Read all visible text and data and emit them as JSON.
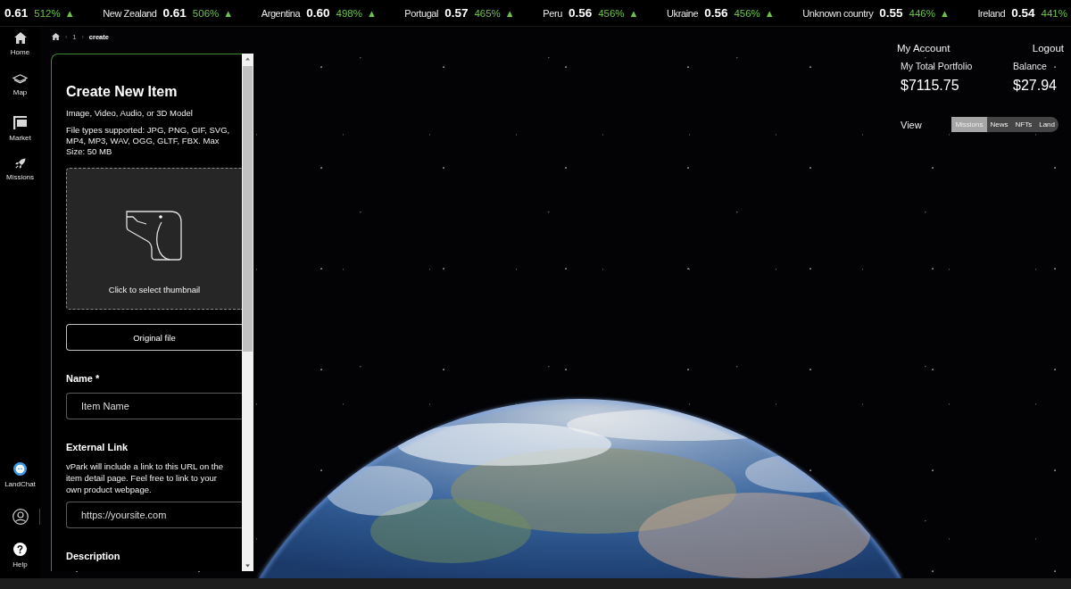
{
  "ticker": [
    {
      "value": "0.61",
      "change": "512%",
      "arrow": "▲"
    },
    {
      "name": "New Zealand",
      "value": "0.61",
      "change": "506%",
      "arrow": "▲"
    },
    {
      "name": "Argentina",
      "value": "0.60",
      "change": "498%",
      "arrow": "▲"
    },
    {
      "name": "Portugal",
      "value": "0.57",
      "change": "465%",
      "arrow": "▲"
    },
    {
      "name": "Peru",
      "value": "0.56",
      "change": "456%",
      "arrow": "▲"
    },
    {
      "name": "Ukraine",
      "value": "0.56",
      "change": "456%",
      "arrow": "▲"
    },
    {
      "name": "Unknown country",
      "value": "0.55",
      "change": "446%",
      "arrow": "▲"
    },
    {
      "name": "Ireland",
      "value": "0.54",
      "change": "441%"
    }
  ],
  "sidebar": {
    "items": [
      {
        "label": "Home"
      },
      {
        "label": "Map"
      },
      {
        "label": "Market"
      },
      {
        "label": "Missions"
      }
    ],
    "chat": {
      "label": "LandChat"
    },
    "help": {
      "label": "Help"
    }
  },
  "breadcrumb": [
    {
      "separator": "›",
      "label": "1"
    },
    {
      "separator": "›",
      "label": "create"
    }
  ],
  "form": {
    "title": "Create New Item",
    "subtitle": "Image, Video, Audio, or 3D Model",
    "file_types": "File types supported: JPG, PNG, GIF, SVG, MP4, MP3, WAV, OGG, GLTF, FBX. Max Size: 50 MB",
    "upload": {
      "label": "Click to select thumbnail"
    },
    "original_file_button": "Original file",
    "fields": [
      {
        "label": "Name *",
        "placeholder": "Item Name"
      },
      {
        "label": "External Link",
        "help": "vPark will include a link to this URL on the item detail page. Feel free to link to your own product webpage.",
        "placeholder": "https://yoursite.com"
      },
      {
        "label": "Description"
      }
    ]
  },
  "account": {
    "title": "My Account",
    "logout": "Logout",
    "stats": [
      {
        "label": "My Total Portfolio",
        "value": "$7115.75"
      },
      {
        "label": "Balance",
        "value": "$27.94"
      }
    ],
    "view": {
      "label": "View",
      "options": [
        {
          "label": "Missions",
          "selected": true
        },
        {
          "label": "News",
          "selected": false
        },
        {
          "label": "NFTs",
          "selected": false
        },
        {
          "label": "Land",
          "selected": false
        }
      ]
    }
  }
}
